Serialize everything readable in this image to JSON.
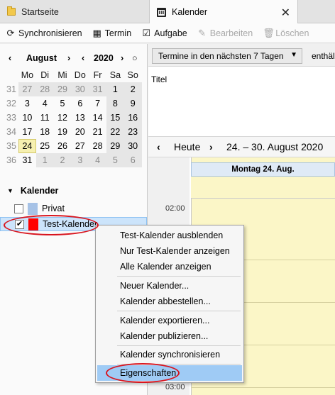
{
  "tabs": [
    {
      "label": "Startseite",
      "icon": "folder-icon",
      "active": false
    },
    {
      "label": "Kalender",
      "icon": "calendar-icon",
      "active": true,
      "close": "✕"
    }
  ],
  "toolbar": {
    "sync": "Synchronisieren",
    "event": "Termin",
    "task": "Aufgabe",
    "edit": "Bearbeiten",
    "delete": "Löschen"
  },
  "minimonth": {
    "month": "August",
    "year": "2020",
    "prev": "‹",
    "next": "›",
    "today_btn": "○",
    "weekdays": [
      "Mo",
      "Di",
      "Mi",
      "Do",
      "Fr",
      "Sa",
      "So"
    ],
    "weeks": [
      {
        "wk": "31",
        "days": [
          "27",
          "28",
          "29",
          "30",
          "31",
          "1",
          "2"
        ]
      },
      {
        "wk": "32",
        "days": [
          "3",
          "4",
          "5",
          "6",
          "7",
          "8",
          "9"
        ]
      },
      {
        "wk": "33",
        "days": [
          "10",
          "11",
          "12",
          "13",
          "14",
          "15",
          "16"
        ]
      },
      {
        "wk": "34",
        "days": [
          "17",
          "18",
          "19",
          "20",
          "21",
          "22",
          "23"
        ]
      },
      {
        "wk": "35",
        "days": [
          "24",
          "25",
          "26",
          "27",
          "28",
          "29",
          "30"
        ]
      },
      {
        "wk": "36",
        "days": [
          "31",
          "1",
          "2",
          "3",
          "4",
          "5",
          "6"
        ]
      }
    ],
    "today": "24"
  },
  "calendars": {
    "section": "Kalender",
    "items": [
      {
        "name": "Privat",
        "color": "#a6c2e6",
        "checked": false
      },
      {
        "name": "Test-Kalender",
        "color": "#ff0000",
        "checked": true
      }
    ]
  },
  "filter": {
    "selected": "Termine in den nächsten 7 Tagen",
    "contains": "enthäl"
  },
  "list": {
    "column": "Titel"
  },
  "week": {
    "today": "Heute",
    "range": "24. – 30. August 2020",
    "day_header": "Montag 24. Aug.",
    "times": [
      "02:00",
      "03:00"
    ]
  },
  "context_menu": {
    "items": [
      "Test-Kalender ausblenden",
      "Nur Test-Kalender anzeigen",
      "Alle Kalender anzeigen",
      "Neuer Kalender...",
      "Kalender abbestellen...",
      "Kalender exportieren...",
      "Kalender publizieren...",
      "Kalender synchronisieren",
      "Eigenschaften"
    ],
    "highlighted": "Eigenschaften"
  },
  "colors": {
    "accent": "#9fcbf5",
    "annotation": "#d8141e",
    "today_bg": "#f6f0b0",
    "day_bg": "#fbf6c7"
  }
}
